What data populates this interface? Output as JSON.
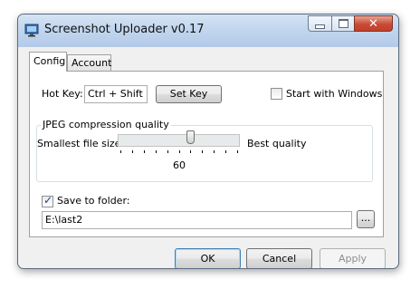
{
  "window": {
    "title": "Screenshot Uploader v0.17",
    "title_icon": "monitor-icon",
    "caption_buttons": [
      "minimize-icon",
      "maximize-icon",
      "close-icon"
    ],
    "close_glyph": "✕"
  },
  "tabs": [
    {
      "label": "Config",
      "active": true
    },
    {
      "label": "Account",
      "active": false
    }
  ],
  "config": {
    "hotkey_label": "Hot Key:",
    "hotkey_value": "Ctrl + Shift +",
    "set_key_label": "Set Key",
    "start_with_windows_label": "Start with Windows",
    "start_with_windows_checked": false,
    "jpeg_group_title": "JPEG compression quality",
    "slider_min_label": "Smallest file size",
    "slider_max_label": "Best quality",
    "quality_value": "60",
    "quality_level": 0.6,
    "save_to_folder_label": "Save to folder:",
    "save_to_folder_checked": true,
    "folder_path": "E:\\last2",
    "browse_label": "..."
  },
  "buttons": {
    "ok": "OK",
    "cancel": "Cancel",
    "apply": "Apply"
  },
  "colors": {
    "titlebar": "#c2d6ee",
    "close_button": "#c94b35",
    "default_button_border": "#3c7fb1"
  }
}
